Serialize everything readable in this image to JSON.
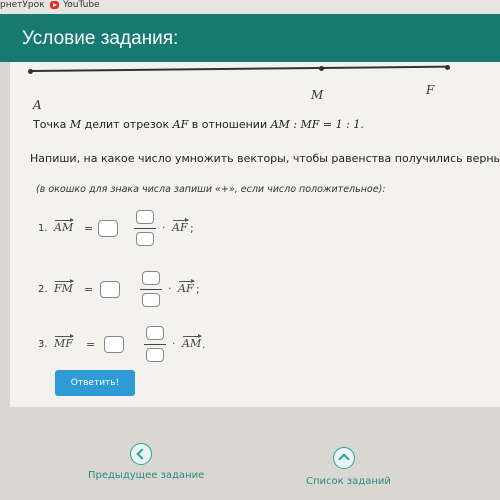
{
  "browser": {
    "bookmarks": [
      {
        "label": "рнетУрок"
      },
      {
        "label": "YouTube",
        "icon": "youtube-icon"
      }
    ]
  },
  "header": {
    "title": "Условие задания:",
    "color": "#167a72"
  },
  "diagram": {
    "points": [
      {
        "label": "A"
      },
      {
        "label": "M"
      },
      {
        "label": "F"
      }
    ]
  },
  "task": {
    "prefix": "Точка ",
    "point": "M",
    "middle": " делит отрезок ",
    "segment": "AF",
    "suffix": " в отношении ",
    "ratio": "AM : MF = 1 : 1."
  },
  "instruction": "Напиши, на какое число умножить векторы, чтобы равенства получились верными",
  "hint": "(в окошко для знака числа запиши «+», если число положительное):",
  "equations": [
    {
      "number": "1.",
      "lhs": "AM",
      "eq": "=",
      "dot": "·",
      "rhs": "AF",
      "trail": ";"
    },
    {
      "number": "2.",
      "lhs": "FM",
      "eq": "=",
      "dot": "·",
      "rhs": "AF",
      "trail": ";"
    },
    {
      "number": "3.",
      "lhs": "MF",
      "eq": "=",
      "dot": "·",
      "rhs": "AM",
      "trail": "."
    }
  ],
  "answer_button": {
    "label": "Ответить!",
    "color": "#2e9bd6"
  },
  "nav": {
    "prev_label": "Предыдущее задание",
    "prev_icon": "chevron-left-icon",
    "list_label": "Список заданий",
    "list_icon": "chevron-up-icon"
  }
}
